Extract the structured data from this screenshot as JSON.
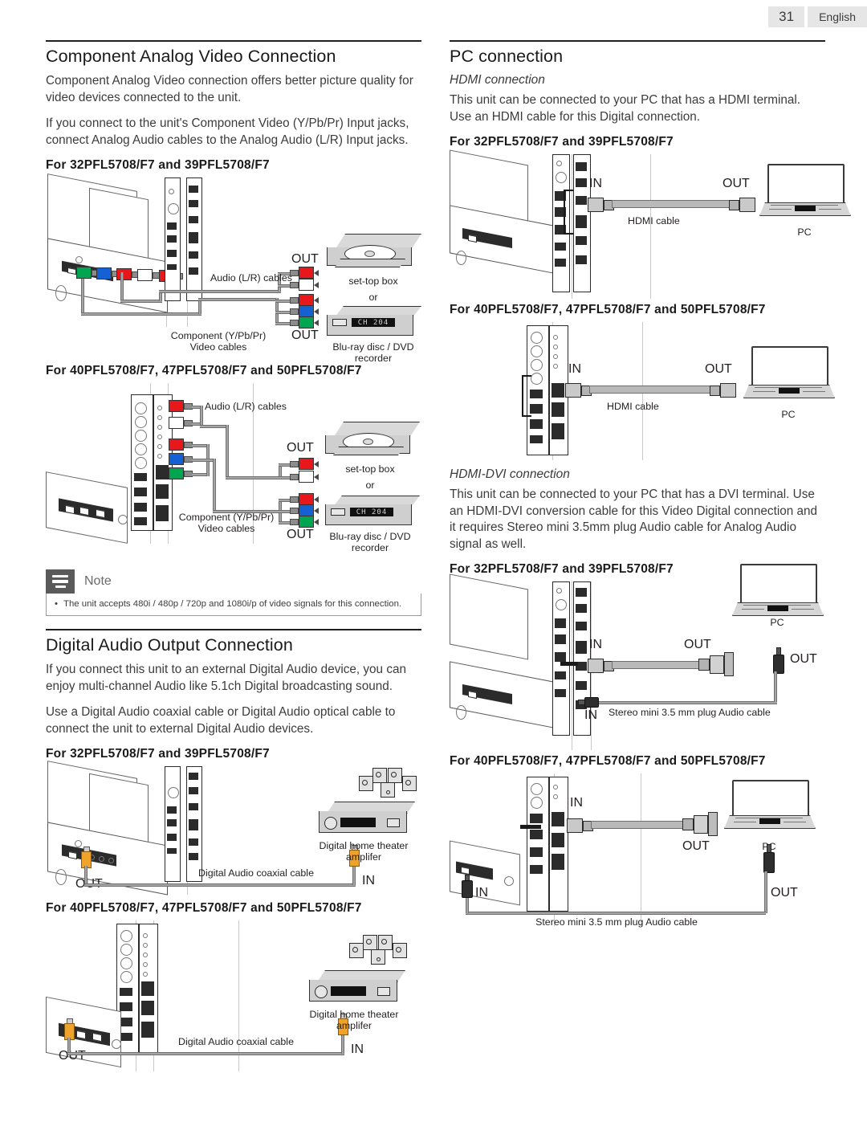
{
  "header": {
    "page_number": "31",
    "language": "English"
  },
  "left_column": {
    "section1": {
      "title": "Component Analog Video Connection",
      "paragraphs": [
        "Component Analog Video connection offers better picture quality for video devices connected to the unit.",
        "If you connect to the unit's Component Video (Y/Pb/Pr) Input jacks, connect Analog Audio cables to the Analog Audio (L/R) Input jacks."
      ],
      "model_heading_1": "For 32PFL5708/F7 and 39PFL5708/F7",
      "model_heading_2": "For 40PFL5708/F7, 47PFL5708/F7 and 50PFL5708/F7",
      "diagram_labels": {
        "audio_cables": "Audio (L/R) cables",
        "component_cables_line1": "Component (Y/Pb/Pr)",
        "component_cables_line2": "Video cables",
        "out": "OUT",
        "settop": "set-top box",
        "or": "or",
        "bluray_line1": "Blu-ray disc / DVD",
        "bluray_line2": "recorder",
        "channel_display": "CH 204"
      }
    },
    "note": {
      "label": "Note",
      "bullet": "•",
      "text": "The unit accepts 480i / 480p / 720p and 1080i/p of video signals for this connection."
    },
    "section2": {
      "title": "Digital Audio Output Connection",
      "paragraphs": [
        "If you connect this unit to an external Digital Audio device, you can enjoy multi-channel Audio like 5.1ch Digital broadcasting sound.",
        "Use a Digital Audio coaxial cable or Digital Audio optical cable to connect the unit to external Digital Audio devices."
      ],
      "model_heading_1": "For 32PFL5708/F7 and 39PFL5708/F7",
      "model_heading_2": "For 40PFL5708/F7, 47PFL5708/F7 and 50PFL5708/F7",
      "diagram_labels": {
        "coax_cable": "Digital Audio coaxial cable",
        "amp_line1": "Digital home theater",
        "amp_line2": "amplifer",
        "in": "IN",
        "out": "OUT"
      }
    }
  },
  "right_column": {
    "section": {
      "title": "PC connection",
      "sub1": {
        "title": "HDMI connection",
        "paragraph": "This unit can be connected to your PC that has a HDMI terminal. Use an HDMI cable for this Digital connection.",
        "model_heading_1": "For 32PFL5708/F7 and 39PFL5708/F7",
        "model_heading_2": "For 40PFL5708/F7, 47PFL5708/F7 and 50PFL5708/F7",
        "diagram_labels": {
          "in": "IN",
          "out": "OUT",
          "hdmi_cable": "HDMI cable",
          "pc": "PC"
        }
      },
      "sub2": {
        "title": "HDMI-DVI connection",
        "paragraph": "This unit can be connected to your PC that has a DVI terminal. Use an HDMI-DVI conversion cable for this Video Digital connection and it requires Stereo mini 3.5mm plug Audio cable for Analog Audio signal as well.",
        "model_heading_1": "For 32PFL5708/F7 and 39PFL5708/F7",
        "model_heading_2": "For 40PFL5708/F7, 47PFL5708/F7 and 50PFL5708/F7",
        "diagram_labels": {
          "in": "IN",
          "out": "OUT",
          "stereo_cable": "Stereo mini 3.5 mm plug Audio cable",
          "pc": "PC"
        }
      }
    }
  },
  "colors": {
    "text": "#231f20",
    "body_text": "#3c3c3c",
    "note_icon_bg": "#5a5a5a",
    "header_chip_bg": "#e6e6e6",
    "rca_red": "#e8171c",
    "rca_white": "#ffffff",
    "rca_blue": "#1560d2",
    "rca_green": "#00a550",
    "coax_orange": "#f0a32a",
    "cable_gray": "#a6a6a6"
  }
}
